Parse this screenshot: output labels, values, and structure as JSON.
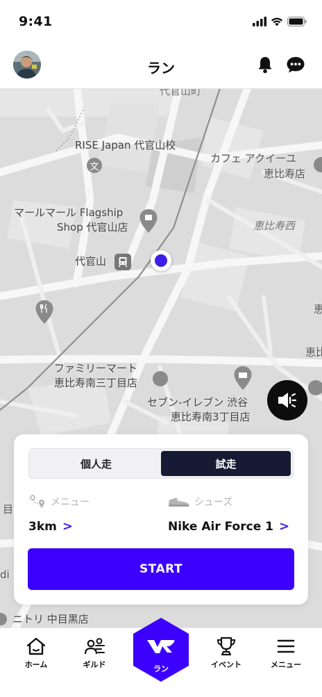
{
  "status_bar": {
    "time": "9:41"
  },
  "header": {
    "title": "ラン"
  },
  "map": {
    "labels": {
      "top_cut": "代官山町",
      "rise_japan": "RISE Japan 代官山校",
      "cafe_line1": "カフェ アクイーユ",
      "cafe_line2": "恵比寿店",
      "marumaru_line1": "マールマール Flagship",
      "marumaru_line2": "Shop 代官山店",
      "ebisu_nishi": "恵比寿西",
      "daikanyama": "代官山",
      "familymart_line1": "ファミリーマート",
      "familymart_line2": "恵比寿南三丁目店",
      "seven_line1": "セブン-イレブン 渋谷",
      "seven_line2": "恵比寿南3丁目店",
      "nitori": "ニトリ 中目黒店",
      "edge_me": "目",
      "edge_di": "di",
      "edge_kei": "恵",
      "edge_ebi": "恵比"
    }
  },
  "run_card": {
    "segments": [
      "個人走",
      "試走"
    ],
    "active_segment": "試走",
    "menu": {
      "label": "メニュー",
      "value": "3km",
      "chevron": ">"
    },
    "shoes": {
      "label": "シューズ",
      "value": "Nike Air Force 1",
      "chevron": ">"
    },
    "start_label": "START"
  },
  "tabbar": {
    "items": [
      {
        "label": "ホーム",
        "icon": "home-icon"
      },
      {
        "label": "ギルド",
        "icon": "guild-icon"
      },
      {
        "label": "ラン",
        "icon": "run-logo-icon"
      },
      {
        "label": "イベント",
        "icon": "trophy-icon"
      },
      {
        "label": "メニュー",
        "icon": "hamburger-icon"
      }
    ]
  },
  "colors": {
    "accent": "#3c00ff",
    "location_dot": "#3a1ee8",
    "segment_active": "#161a33",
    "map_bg": "#dcdcdc"
  }
}
